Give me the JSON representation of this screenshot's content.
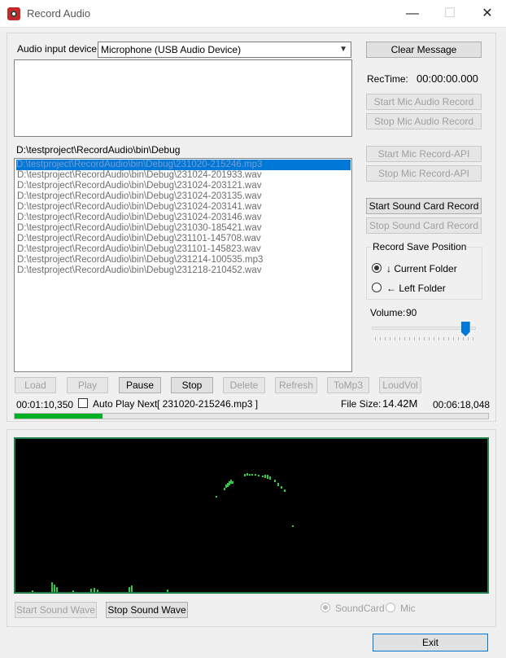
{
  "window": {
    "title": "Record Audio",
    "minimize": "—",
    "maximize": "☐",
    "close": "✕"
  },
  "input_device": {
    "label": "Audio input device:",
    "value": "Microphone (USB Audio Device)"
  },
  "folder_path": "D:\\testproject\\RecordAudio\\bin\\Debug",
  "files": [
    "D:\\testproject\\RecordAudio\\bin\\Debug\\231020-215246.mp3",
    "D:\\testproject\\RecordAudio\\bin\\Debug\\231024-201933.wav",
    "D:\\testproject\\RecordAudio\\bin\\Debug\\231024-203121.wav",
    "D:\\testproject\\RecordAudio\\bin\\Debug\\231024-203135.wav",
    "D:\\testproject\\RecordAudio\\bin\\Debug\\231024-203141.wav",
    "D:\\testproject\\RecordAudio\\bin\\Debug\\231024-203146.wav",
    "D:\\testproject\\RecordAudio\\bin\\Debug\\231030-185421.wav",
    "D:\\testproject\\RecordAudio\\bin\\Debug\\231101-145708.wav",
    "D:\\testproject\\RecordAudio\\bin\\Debug\\231101-145823.wav",
    "D:\\testproject\\RecordAudio\\bin\\Debug\\231214-100535.mp3",
    "D:\\testproject\\RecordAudio\\bin\\Debug\\231218-210452.wav"
  ],
  "right_panel": {
    "clear_message": "Clear Message",
    "rectime_label": "RecTime:",
    "rectime_value": "00:00:00.000",
    "start_mic": "Start Mic Audio Record",
    "stop_mic": "Stop Mic Audio Record",
    "start_mic_api": "Start Mic Record-API",
    "stop_mic_api": "Stop Mic Record-API",
    "start_sound_card": "Start Sound Card Record",
    "stop_sound_card": "Stop Sound Card Record",
    "save_position_title": "Record Save Position",
    "current_folder": "↓ Current Folder",
    "left_folder": "← Left Folder",
    "volume_label": "Volume:",
    "volume_value": "90",
    "volume_level": 0.9
  },
  "playback": {
    "load": "Load",
    "play": "Play",
    "pause": "Pause",
    "stop": "Stop",
    "delete": "Delete",
    "refresh": "Refresh",
    "tomp3": "ToMp3",
    "loudvol": "LoudVol",
    "position": "00:01:10,350",
    "auto_play_label": "Auto Play Next",
    "current_file": "[ 231020-215246.mp3 ]",
    "file_size_label": "File Size:",
    "file_size_value": "14.42M",
    "duration": "00:06:18,048",
    "progress": 0.186
  },
  "wave": {
    "start_wave": "Start Sound Wave",
    "stop_wave": "Stop Sound Wave",
    "source_soundcard": "SoundCard",
    "source_mic": "Mic"
  },
  "exit": "Exit",
  "colors": {
    "accent": "#0078d7",
    "wave_green": "#2ecc40",
    "progress_green": "#06b025"
  }
}
